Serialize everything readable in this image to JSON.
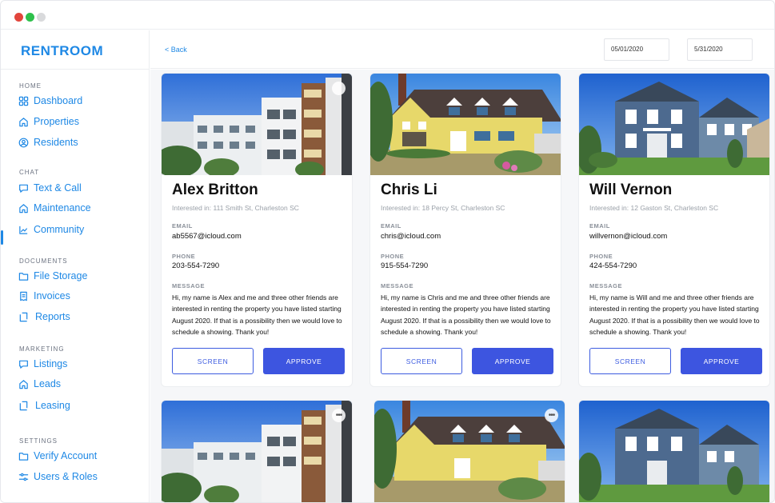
{
  "app": {
    "brand": "RENTROOM"
  },
  "sidebar": {
    "sections": [
      {
        "title": "HOME",
        "items": [
          {
            "label": "Dashboard",
            "icon": "grid-icon"
          },
          {
            "label": "Properties",
            "icon": "home-icon"
          },
          {
            "label": "Residents",
            "icon": "user-circle-icon"
          }
        ]
      },
      {
        "title": "CHAT",
        "items": [
          {
            "label": "Text & Call",
            "icon": "chat-icon"
          },
          {
            "label": "Maintenance",
            "icon": "home-icon",
            "active": true
          },
          {
            "label": "Community",
            "icon": "chart-icon"
          }
        ]
      },
      {
        "title": "DOCUMENTS",
        "items": [
          {
            "label": "File Storage",
            "icon": "folder-icon"
          },
          {
            "label": "Invoices",
            "icon": "invoice-icon"
          },
          {
            "label": "Reports",
            "icon": "report-icon"
          }
        ]
      },
      {
        "title": "MARKETING",
        "items": [
          {
            "label": "Listings",
            "icon": "chat-icon"
          },
          {
            "label": "Leads",
            "icon": "home-icon"
          },
          {
            "label": "Leasing",
            "icon": "report-icon"
          }
        ]
      },
      {
        "title": "SETTINGS",
        "items": [
          {
            "label": "Verify Account",
            "icon": "folder-icon"
          },
          {
            "label": "Users & Roles",
            "icon": "sliders-icon"
          }
        ]
      }
    ]
  },
  "topbar": {
    "back_label": "< Back",
    "start_date": "05/01/2020",
    "end_date": "5/31/2020"
  },
  "labels": {
    "email": "EMAIL",
    "phone": "PHONE",
    "message": "MESSAGE",
    "screen": "SCREEN",
    "approve": "APPROVE"
  },
  "applicants": [
    {
      "name": "Alex Britton",
      "interested": "Interested in: 111 Smith St, Charleston SC",
      "email": "ab5567@icloud.com",
      "phone": "203-554-7290",
      "message": "Hi, my name is Alex and me and three other friends are interested in renting the property you have listed starting August 2020. If that is a possibility then we would love to schedule a showing. Thank you!",
      "photo": "apartment"
    },
    {
      "name": "Chris Li",
      "interested": "Interested in: 18 Percy St, Charleston SC",
      "email": "chris@icloud.com",
      "phone": "915-554-7290",
      "message": "Hi, my name is Chris and me and three other friends are interested in renting the property you have listed starting August 2020. If that is a possibility then we would love to schedule a showing. Thank you!",
      "photo": "yellow-house"
    },
    {
      "name": "Will Vernon",
      "interested": "Interested in: 12 Gaston St, Charleston SC",
      "email": "willvernon@icloud.com",
      "phone": "424-554-7290",
      "message": "Hi, my name is Will and me and three other friends are interested in renting the property you have listed starting August 2020. If that is a possibility then we would love to schedule a showing. Thank you!",
      "photo": "blue-house"
    }
  ],
  "colors": {
    "accent": "#1e88e5",
    "primary_button": "#3d55e0",
    "muted_text": "#9aa0a8"
  }
}
